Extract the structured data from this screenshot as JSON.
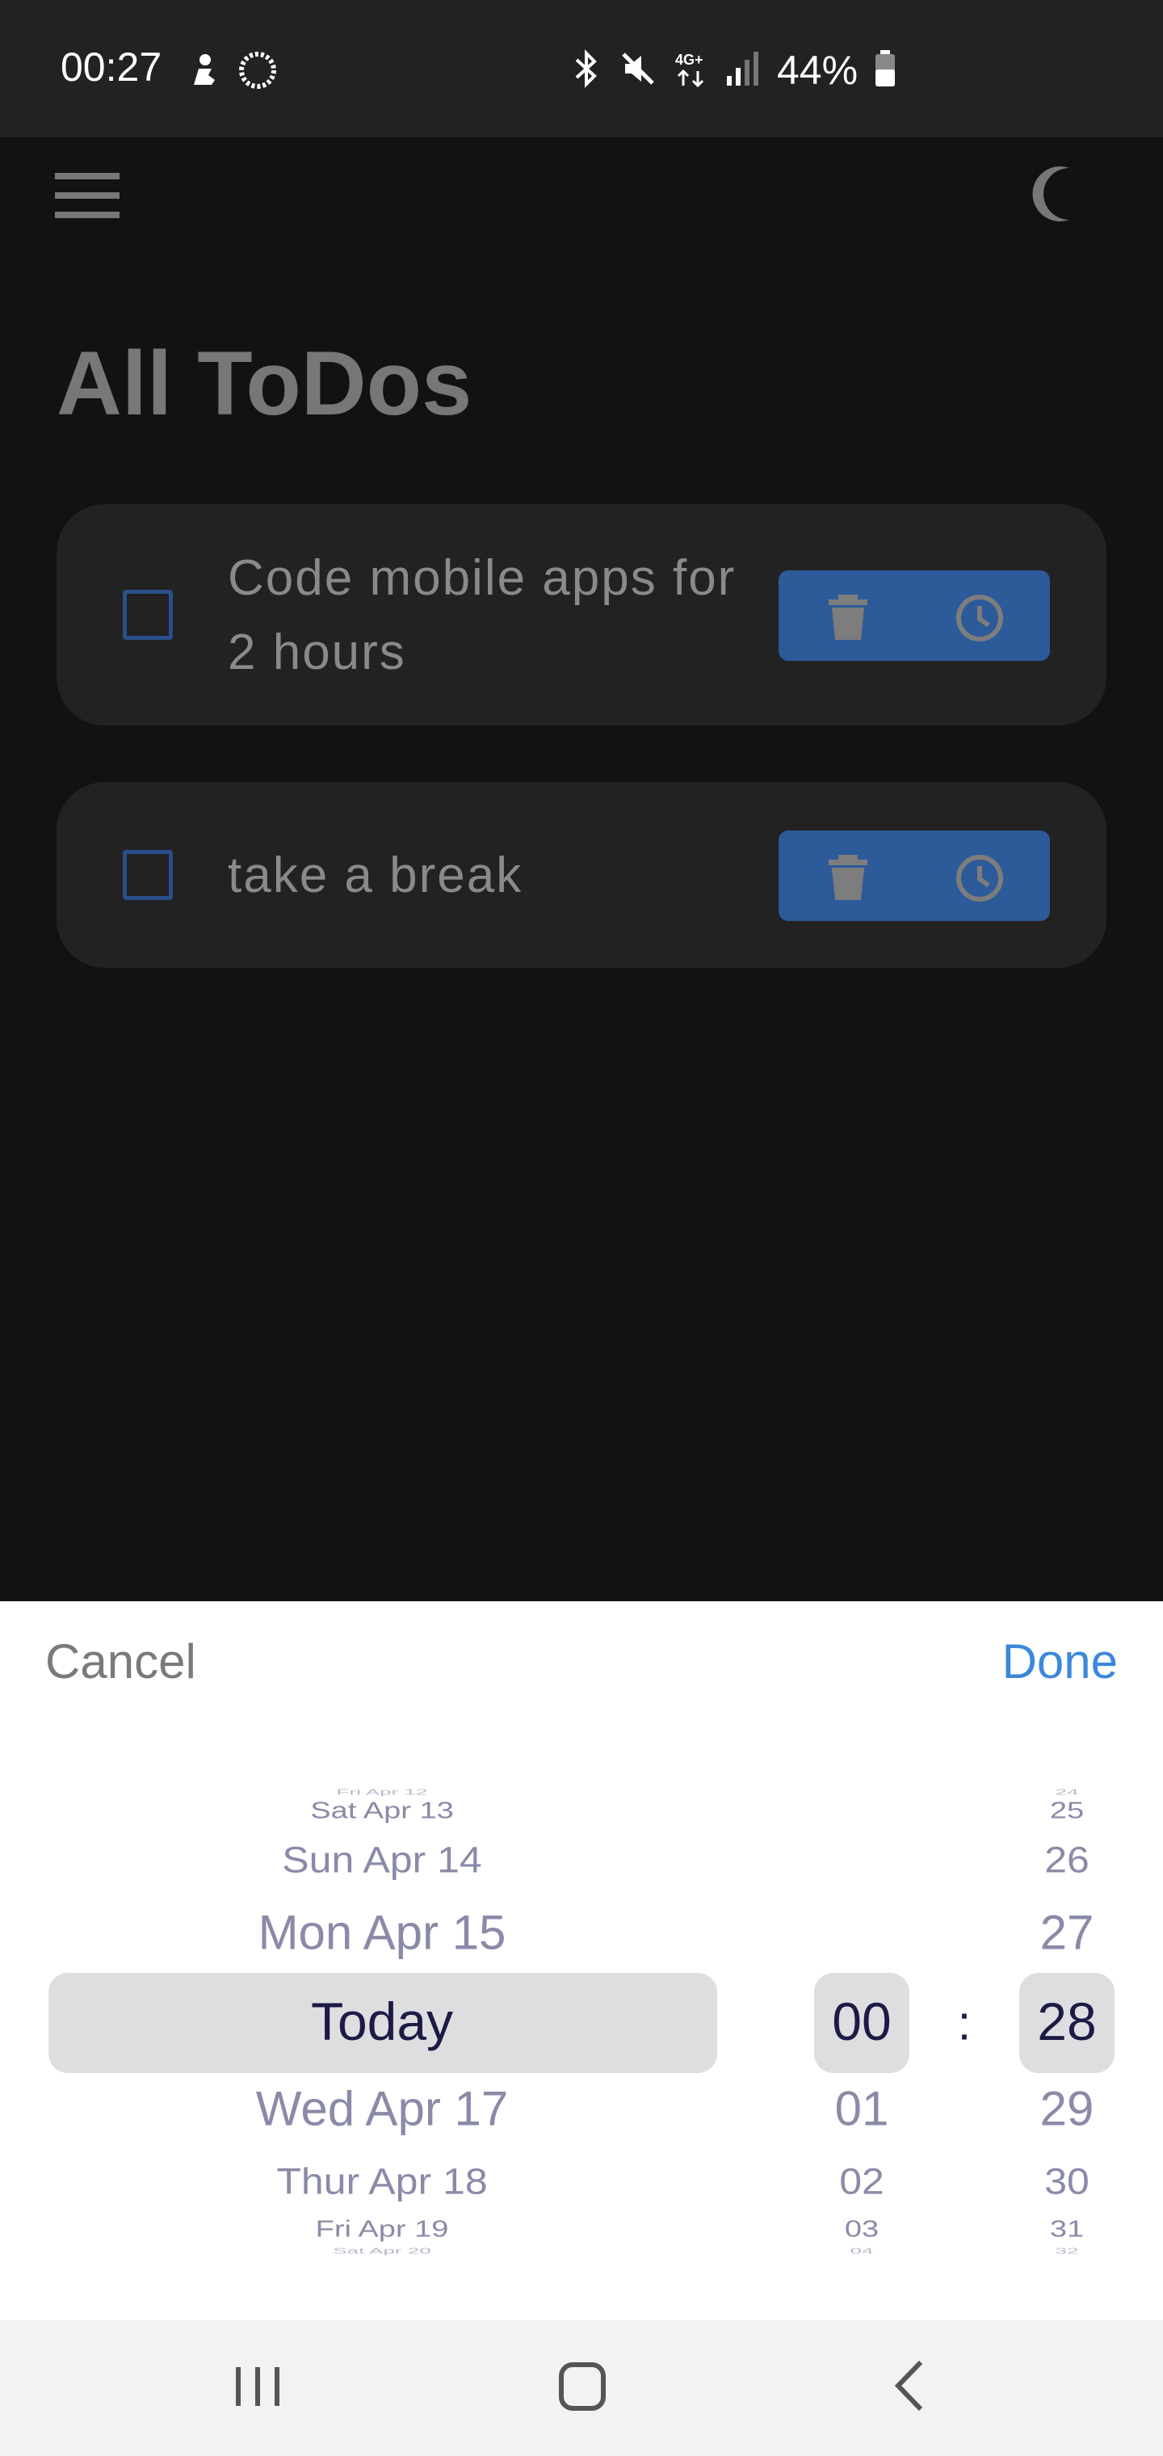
{
  "status_bar": {
    "time": "00:27",
    "battery_percent": "44%",
    "network_label": "4G+"
  },
  "app_bar": {
    "menu_icon": "hamburger-menu-icon",
    "theme_icon": "moon-icon"
  },
  "page": {
    "title": "All ToDos"
  },
  "todos": [
    {
      "text": "Code mobile apps for 2 hours",
      "checked": false
    },
    {
      "text": "take a break",
      "checked": false
    }
  ],
  "picker": {
    "cancel_label": "Cancel",
    "done_label": "Done",
    "date_wheel": {
      "above": [
        "Fri Apr 12",
        "Sat Apr 13",
        "Sun Apr 14",
        "Mon Apr 15"
      ],
      "selected": "Today",
      "below": [
        "Wed Apr 17",
        "Thur Apr 18",
        "Fri Apr 19",
        "Sat Apr 20"
      ]
    },
    "hour_wheel": {
      "selected": "00",
      "below": [
        "01",
        "02",
        "03",
        "04"
      ]
    },
    "minute_wheel": {
      "above": [
        "24",
        "25",
        "26",
        "27"
      ],
      "selected": "28",
      "below": [
        "29",
        "30",
        "31",
        "32"
      ]
    },
    "separator": ":"
  },
  "colors": {
    "accent": "#3b88db",
    "action_button": "#2d5a99",
    "selected_text": "#1b1b45"
  }
}
